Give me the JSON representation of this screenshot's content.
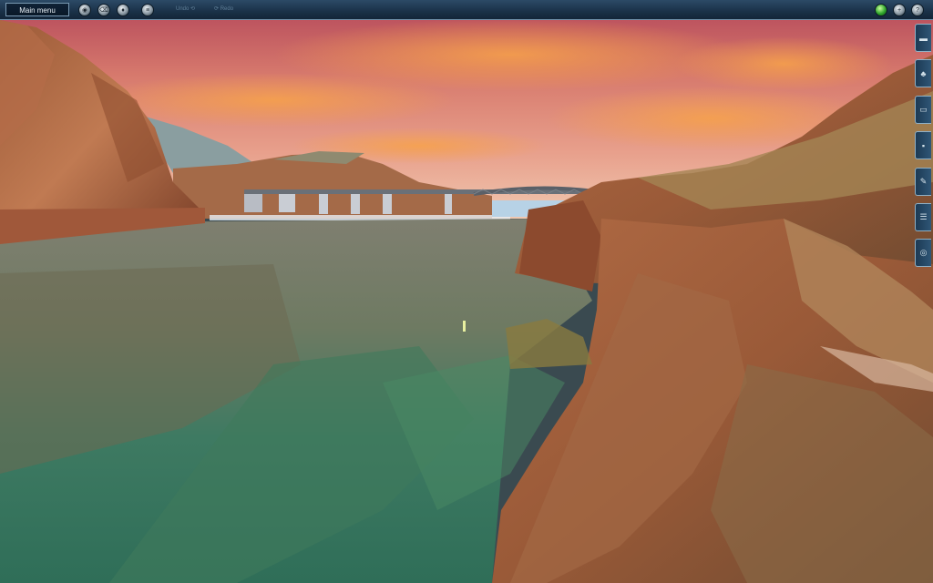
{
  "toolbar": {
    "main_menu_label": "Main menu",
    "undo_label": "Undo",
    "redo_label": "Redo"
  },
  "icons": {
    "left": [
      "camera-icon",
      "delete-icon",
      "paint-icon",
      "list-icon"
    ],
    "right": [
      "status-green-icon",
      "add-icon",
      "help-icon"
    ],
    "sidebar": [
      "track-tool-icon",
      "scenery-tool-icon",
      "train-tool-icon",
      "texture-tool-icon",
      "wrench-tool-icon",
      "layers-tool-icon",
      "settings-tool-icon"
    ]
  },
  "colors": {
    "toolbar_bg": "#1a3148",
    "toolbar_border": "#6f8fa8",
    "status_green": "#2fa52c"
  }
}
